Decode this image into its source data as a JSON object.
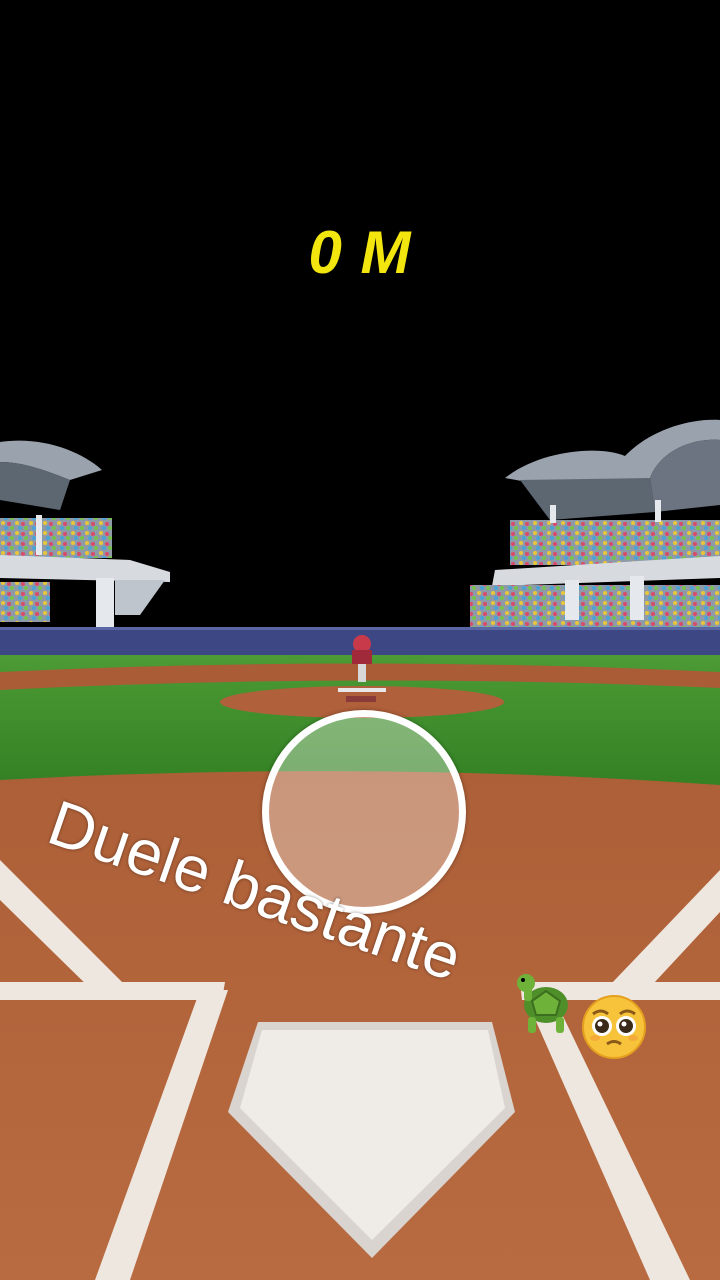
{
  "hud": {
    "distance": "0 M"
  },
  "overlay": {
    "caption": "Duele bastante"
  },
  "colors": {
    "distance_text": "#f3e60f",
    "grass": "#3f8f2c",
    "dirt": "#b5663c",
    "sky": "#000000",
    "outfield_wall": "#3c4784"
  },
  "icons": [
    "turtle-emoji",
    "pleading-face-emoji",
    "aim-reticle"
  ]
}
